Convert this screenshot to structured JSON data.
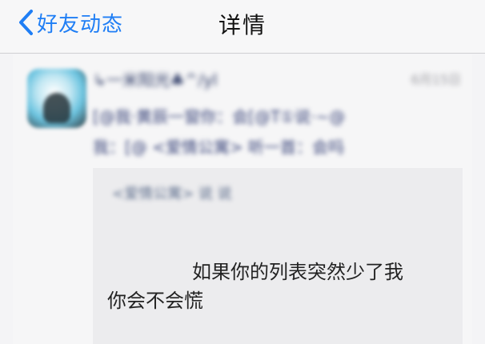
{
  "navbar": {
    "back_label": "好友动态",
    "title": "详情"
  },
  "post": {
    "nickname": "↳一米阳光♣^/yl",
    "timestamp": "6月15日",
    "text_line1": "[@我·黄辰一窗你：会[@T①说·~@",
    "text_line2": "我：[@ <爱情公寓> 听一首：会吗",
    "quote": {
      "title": "<爱情公寓> 说 说",
      "line1": "如果你的列表突然少了我",
      "line2": "你会不会慌"
    }
  },
  "colors": {
    "accent": "#1f7ef5",
    "nickname": "#2d3a66"
  }
}
